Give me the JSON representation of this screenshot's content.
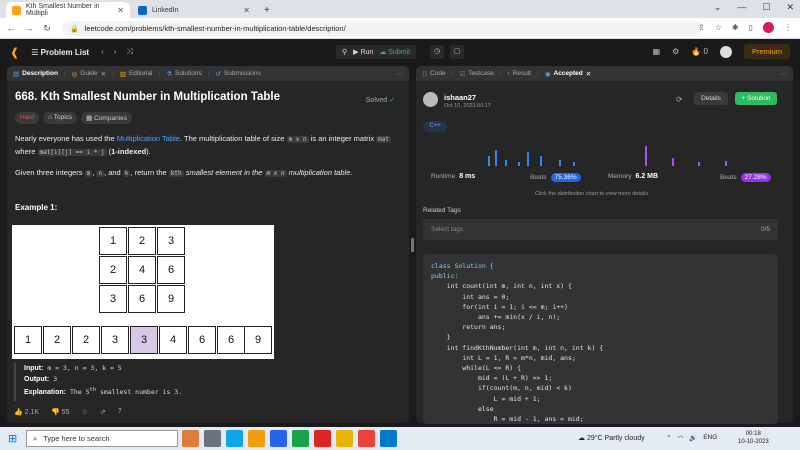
{
  "browser": {
    "tabs": [
      {
        "title": "Kth Smallest Number in Multipli",
        "favicon_color": "#ffa116",
        "active": true
      },
      {
        "title": "LinkedIn",
        "favicon_color": "#0a66c2",
        "active": false
      }
    ],
    "new_tab": "+",
    "url": "leetcode.com/problems/kth-smallest-number-in-multiplication-table/description/"
  },
  "lc_nav": {
    "problem_list": "Problem List",
    "run_label": "Run",
    "submit_label": "Submit",
    "streak": "0",
    "premium": "Premium"
  },
  "left_tabs": [
    {
      "label": "Description",
      "active": true
    },
    {
      "label": "Guide",
      "active": false
    },
    {
      "label": "Editorial",
      "active": false
    },
    {
      "label": "Solutions",
      "active": false
    },
    {
      "label": "Submissions",
      "active": false
    }
  ],
  "problem": {
    "title": "668. Kth Smallest Number in Multiplication Table",
    "status": "Solved",
    "difficulty": "Hard",
    "tag_topics": "Topics",
    "tag_companies": "Companies",
    "p1_a": "Nearly everyone has used the ",
    "p1_link": "Multiplication Table",
    "p1_b": ". The multiplication table of size ",
    "p1_code1": "m x n",
    "p1_c": " is an integer matrix ",
    "p1_code2": "mat",
    "p1_d": "where ",
    "p1_code3": "mat[i][j] == i * j",
    "p1_e": " (",
    "p1_bold": "1-indexed",
    "p1_f": ").",
    "p2_a": "Given three integers ",
    "p2_m": "m",
    "p2_n": "n",
    "p2_and": ", and ",
    "p2_k": "k",
    "p2_b": ", return the ",
    "p2_kth": "kth",
    "p2_c": " smallest element in the ",
    "p2_mxn": "m x n",
    "p2_d": " multiplication table.",
    "example_title": "Example 1:",
    "grid": [
      [
        "1",
        "2",
        "3"
      ],
      [
        "2",
        "4",
        "6"
      ],
      [
        "3",
        "6",
        "9"
      ]
    ],
    "sorted_row": [
      "1",
      "2",
      "2",
      "3",
      "3",
      "4",
      "6",
      "6",
      "9"
    ],
    "highlight_index": 4,
    "ex_input_label": "Input:",
    "ex_input": "m = 3, n = 3, k = 5",
    "ex_output_label": "Output:",
    "ex_output": "3",
    "ex_expl_label": "Explanation:",
    "ex_expl_a": "The 5",
    "ex_expl_sup": "th",
    "ex_expl_b": " smallest number is 3.",
    "likes": "2.1K",
    "dislikes": "55"
  },
  "right_tabs": [
    {
      "label": "Code"
    },
    {
      "label": "Testcase"
    },
    {
      "label": "Result"
    },
    {
      "label": "Accepted"
    }
  ],
  "submission": {
    "user": "ishaan27",
    "date": "Oct 10, 2023 00:17",
    "details_btn": "Details",
    "solution_btn": "+ Solution",
    "language": "C++",
    "runtime_label": "Runtime",
    "runtime": "8 ms",
    "runtime_beats_label": "Beats",
    "runtime_beats": "75.36%",
    "memory_label": "Memory",
    "memory": "6.2 MB",
    "memory_beats_label": "Beats",
    "memory_beats": "27.28%",
    "dist_hint": "Click the distribution chart to view more details",
    "related_tags": "Related Tags",
    "select_tags": "Select tags",
    "tag_count": "0/5",
    "colors": {
      "runtime": "#3b82f6",
      "memory": "#a855f7"
    }
  },
  "code_lines": [
    "class Solution {",
    "public:",
    "    int count(int m, int n, int x) {",
    "        int ans = 0;",
    "        for(int i = 1; i <= m; i++)",
    "            ans += min(x / i, n);",
    "        return ans;",
    "    }",
    "    int findKthNumber(int m, int n, int k) {",
    "        int L = 1, R = m*n, mid, ans;",
    "        while(L <= R) {",
    "            mid = (L + R) >> 1;",
    "            if(count(m, n, mid) < k)",
    "                L = mid + 1;",
    "            else",
    "                R = mid - 1, ans = mid;"
  ],
  "taskbar": {
    "search_placeholder": "Type here to search",
    "weather": "29°C  Partly cloudy",
    "lang": "ENG",
    "time": "00:18",
    "date": "10-10-2023"
  }
}
